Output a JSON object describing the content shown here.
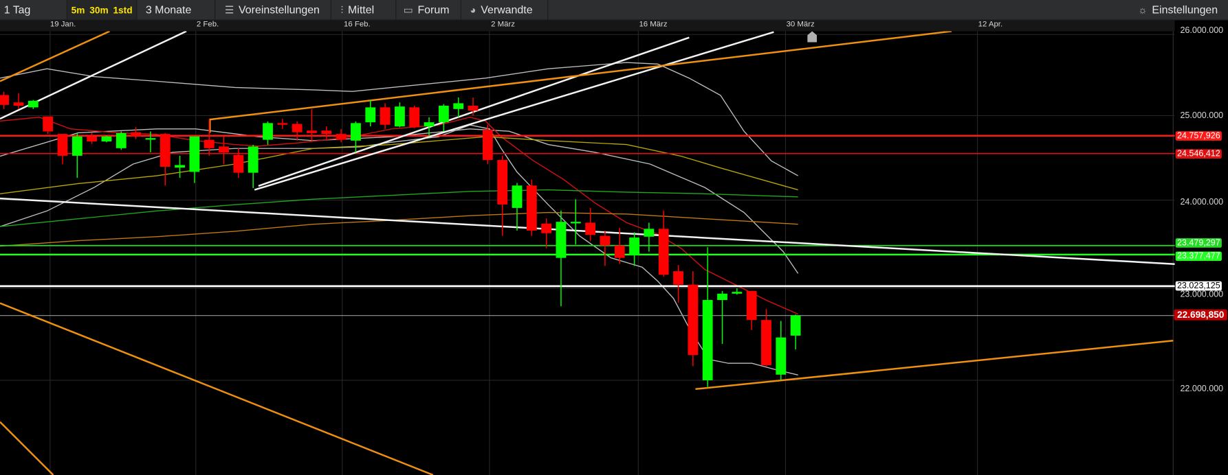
{
  "toolbar": {
    "interval": "1 Tag",
    "quick_intervals": [
      "5m",
      "30m",
      "1std"
    ],
    "range": "3 Monate",
    "presets": "Voreinstellungen",
    "indicators": "Mittel",
    "forum": "Forum",
    "related": "Verwandte",
    "settings": "Einstellungen",
    "icons": {
      "presets": "sliders-icon",
      "indicators": "candles-icon",
      "forum": "speech-bubble-icon",
      "related": "related-icon",
      "settings": "gear-icon"
    }
  },
  "chart_data": {
    "type": "candlestick",
    "y_scale": "log",
    "ylim": [
      21.6,
      26.05
    ],
    "x_tick_labels": [
      "19 Jan.",
      "2 Feb.",
      "16 Feb.",
      "2 März",
      "16 März",
      "30 März",
      "12 Apr."
    ],
    "y_tick_labels": [
      "26.000.000",
      "25.000.000",
      "24.000.000",
      "23.000.000",
      "22.000.000"
    ],
    "y_ticks": [
      26,
      25,
      24,
      23,
      22
    ],
    "colors": {
      "up": "#00ff00",
      "down": "#ff0000",
      "background": "#000000"
    },
    "candles_ohlc": [
      [
        25.25,
        25.29,
        25.08,
        25.13
      ],
      [
        25.16,
        25.27,
        25.08,
        25.12
      ],
      [
        25.1,
        25.19,
        25.08,
        25.18
      ],
      [
        24.99,
        24.99,
        24.78,
        24.81
      ],
      [
        24.78,
        24.78,
        24.42,
        24.52
      ],
      [
        24.52,
        24.79,
        24.26,
        24.75
      ],
      [
        24.75,
        24.79,
        24.66,
        24.69
      ],
      [
        24.69,
        24.76,
        24.68,
        24.75
      ],
      [
        24.61,
        24.81,
        24.59,
        24.79
      ],
      [
        24.8,
        24.86,
        24.72,
        24.75
      ],
      [
        24.72,
        24.81,
        24.56,
        24.73
      ],
      [
        24.78,
        24.79,
        24.17,
        24.39
      ],
      [
        24.38,
        24.52,
        24.26,
        24.41
      ],
      [
        24.33,
        24.75,
        24.2,
        24.75
      ],
      [
        24.71,
        24.96,
        24.52,
        24.61
      ],
      [
        24.63,
        24.75,
        24.42,
        24.56
      ],
      [
        24.53,
        24.61,
        24.26,
        24.32
      ],
      [
        24.32,
        24.65,
        24.14,
        24.63
      ],
      [
        24.71,
        24.93,
        24.65,
        24.91
      ],
      [
        24.91,
        24.96,
        24.84,
        24.89
      ],
      [
        24.9,
        24.93,
        24.7,
        24.8
      ],
      [
        24.82,
        25.08,
        24.7,
        24.79
      ],
      [
        24.82,
        24.87,
        24.72,
        24.78
      ],
      [
        24.78,
        24.84,
        24.68,
        24.71
      ],
      [
        24.7,
        24.93,
        24.56,
        24.91
      ],
      [
        24.92,
        25.19,
        24.87,
        25.1
      ],
      [
        25.1,
        25.15,
        24.84,
        24.89
      ],
      [
        24.87,
        25.16,
        24.86,
        25.11
      ],
      [
        25.1,
        25.12,
        24.85,
        24.86
      ],
      [
        24.87,
        24.98,
        24.75,
        24.92
      ],
      [
        24.92,
        25.14,
        24.81,
        25.12
      ],
      [
        25.08,
        25.22,
        24.98,
        25.15
      ],
      [
        25.12,
        25.22,
        25.0,
        25.06
      ],
      [
        24.83,
        24.89,
        24.42,
        24.47
      ],
      [
        24.47,
        24.52,
        23.59,
        23.95
      ],
      [
        23.91,
        24.2,
        23.65,
        24.17
      ],
      [
        24.17,
        24.24,
        23.59,
        23.65
      ],
      [
        23.73,
        23.79,
        23.45,
        23.62
      ],
      [
        23.34,
        23.88,
        22.8,
        23.75
      ],
      [
        23.74,
        24.01,
        23.49,
        23.75
      ],
      [
        23.74,
        23.91,
        23.53,
        23.6
      ],
      [
        23.59,
        23.65,
        23.25,
        23.48
      ],
      [
        23.48,
        23.68,
        23.27,
        23.34
      ],
      [
        23.37,
        23.63,
        23.25,
        23.57
      ],
      [
        23.58,
        23.74,
        23.41,
        23.67
      ],
      [
        23.67,
        23.88,
        23.13,
        23.15
      ],
      [
        23.19,
        23.26,
        22.84,
        23.04
      ],
      [
        23.04,
        23.19,
        22.15,
        22.27
      ],
      [
        22.0,
        23.46,
        21.93,
        22.87
      ],
      [
        22.87,
        22.97,
        22.39,
        22.94
      ],
      [
        22.94,
        23.0,
        22.93,
        22.96
      ],
      [
        22.97,
        22.97,
        22.54,
        22.65
      ],
      [
        22.65,
        22.77,
        22.15,
        22.16
      ],
      [
        22.06,
        22.64,
        22.0,
        22.46
      ],
      [
        22.48,
        22.71,
        22.33,
        22.7
      ]
    ],
    "price_levels": [
      {
        "label": "24.757,926",
        "value": 24.757926,
        "color": "#ff1a1a"
      },
      {
        "label": "24.546,412",
        "value": 24.546412,
        "color": "#e01010"
      },
      {
        "label": "23.479,297",
        "value": 23.479297,
        "color": "#22dd22"
      },
      {
        "label": "23.377,477",
        "value": 23.377477,
        "color": "#22ff22"
      },
      {
        "label": "23.023,125",
        "value": 23.023125,
        "color": "#ffffff"
      },
      {
        "label": "22.698,850",
        "value": 22.69885,
        "color": "#c00000"
      }
    ]
  }
}
